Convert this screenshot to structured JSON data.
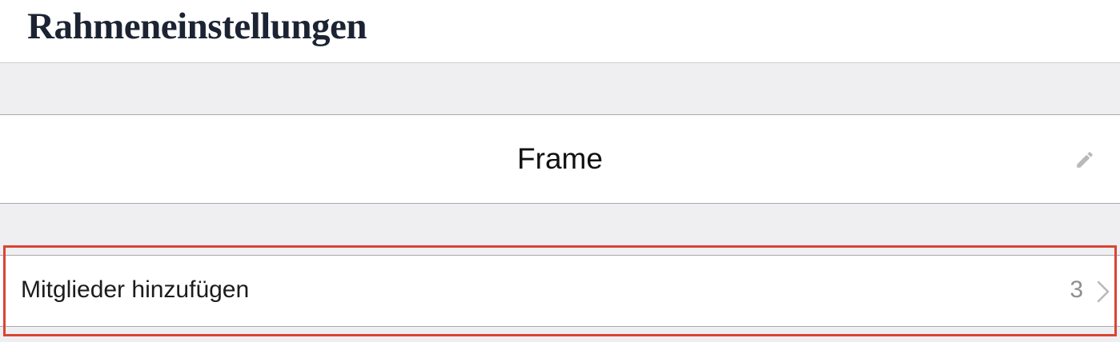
{
  "header": {
    "title": "Rahmeneinstellungen"
  },
  "frame": {
    "name": "Frame",
    "edit_icon": "pencil-icon"
  },
  "members": {
    "label": "Mitglieder hinzufügen",
    "count": "3",
    "chevron_icon": "chevron-right-icon"
  },
  "colors": {
    "highlight": "#d94535",
    "background": "#efeff1",
    "title": "#1c2433",
    "secondary_text": "#8e8e93"
  }
}
